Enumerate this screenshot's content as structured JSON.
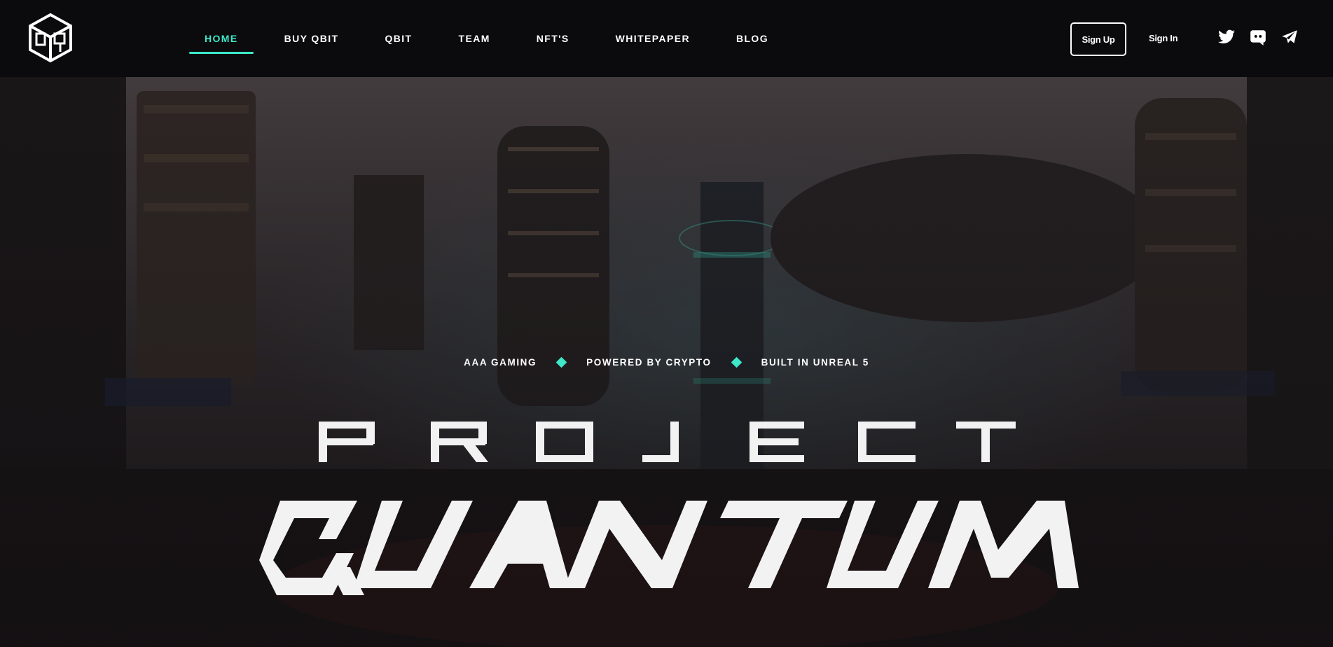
{
  "brand": {
    "logo_icon": "hexagon-cube-logo-icon"
  },
  "nav": {
    "items": [
      {
        "label": "HOME",
        "active": true
      },
      {
        "label": "BUY QBIT",
        "active": false
      },
      {
        "label": "QBIT",
        "active": false
      },
      {
        "label": "TEAM",
        "active": false
      },
      {
        "label": "NFT'S",
        "active": false
      },
      {
        "label": "WHITEPAPER",
        "active": false
      },
      {
        "label": "BLOG",
        "active": false
      }
    ]
  },
  "auth": {
    "signup_label": "Sign Up",
    "signin_label": "Sign In"
  },
  "social": [
    {
      "name": "twitter-icon"
    },
    {
      "name": "discord-icon"
    },
    {
      "name": "telegram-icon"
    }
  ],
  "hero": {
    "taglines": [
      "AAA GAMING",
      "POWERED BY CRYPTO",
      "BUILT IN UNREAL 5"
    ],
    "title_top": "PROJECT",
    "title_main": "QUANTUM"
  },
  "colors": {
    "accent": "#3ee8c8",
    "background": "#0b0b0e",
    "text": "#ffffff"
  }
}
